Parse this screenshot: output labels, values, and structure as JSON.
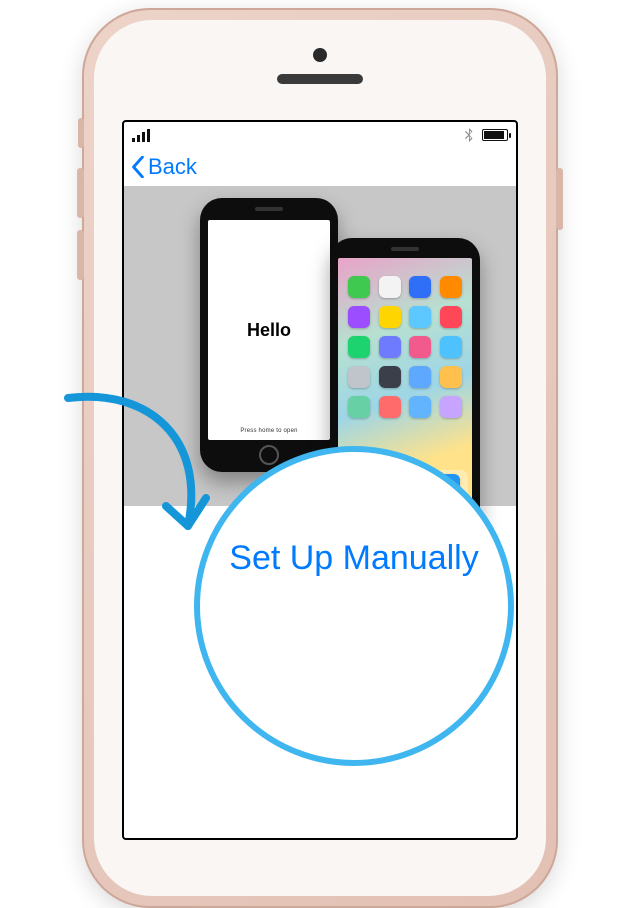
{
  "nav": {
    "back_label": "Back"
  },
  "hello_phone": {
    "greeting": "Hello",
    "hint": "Press home to open"
  },
  "setup": {
    "manual_label": "Set Up Manually"
  },
  "colors": {
    "ios_blue": "#007aff",
    "highlight_ring": "#3fb6ef"
  },
  "app_colors": [
    "#3fc951",
    "#f3f3f3",
    "#2f6ef7",
    "#ff8a00",
    "#9c4dff",
    "#ffd500",
    "#5cc8ff",
    "#ff4757",
    "#1dd36f",
    "#6f7bff",
    "#f25a8e",
    "#4dc2ff",
    "#c0c5cc",
    "#3a3f4a",
    "#5fa8ff",
    "#ffc04d",
    "#67d1a5",
    "#ff6b6b",
    "#63b4ff",
    "#c7a4ff"
  ],
  "dock_colors": [
    "#34c759",
    "#ffffff",
    "#ff4f6d",
    "#2196f3"
  ]
}
